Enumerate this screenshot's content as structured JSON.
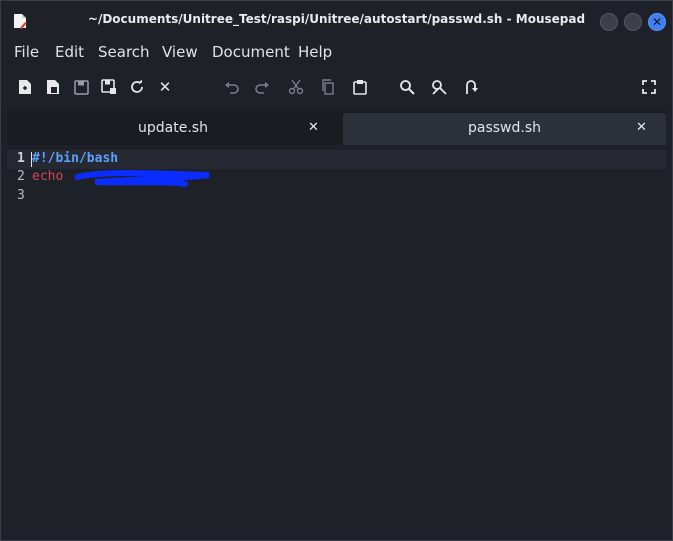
{
  "window": {
    "title": "~/Documents/Unitree_Test/raspi/Unitree/autostart/passwd.sh - Mousepad",
    "close_glyph": "✕"
  },
  "menu": [
    "File",
    "Edit",
    "Search",
    "View",
    "Document",
    "Help"
  ],
  "toolbar": {
    "icons": [
      "new-document-icon",
      "new-window-icon",
      "save-icon",
      "save-as-icon",
      "reload-icon",
      "close-tab-icon",
      "undo-icon",
      "redo-icon",
      "cut-icon",
      "copy-icon",
      "paste-icon",
      "find-icon",
      "find-replace-icon",
      "goto-line-icon",
      "fullscreen-icon"
    ],
    "close_glyph": "✕"
  },
  "tabs": [
    {
      "label": "update.sh",
      "active": false,
      "close": "✕"
    },
    {
      "label": "passwd.sh",
      "active": true,
      "close": "✕"
    }
  ],
  "editor": {
    "lines": [
      {
        "number": "1",
        "text": "#!/bin/bash"
      },
      {
        "number": "2",
        "text": "echo"
      },
      {
        "number": "3",
        "text": ""
      }
    ],
    "redaction_color": "#0a2cff"
  },
  "colors": {
    "accent": "#3f7ff0",
    "shebang": "#5aa0ff",
    "keyword": "#d2455a"
  }
}
